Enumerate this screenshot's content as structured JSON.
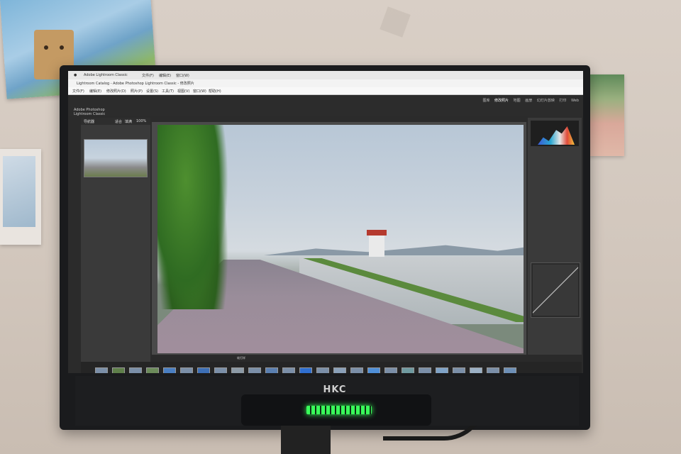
{
  "monitor": {
    "brand": "HKC"
  },
  "system_menu": [
    "Adobe Lightroom Classic",
    "文件(F)",
    "编辑(E)",
    "窗口(W)"
  ],
  "window_title": "Lightroom Catalog - Adobe Photoshop Lightroom Classic - 修改照片",
  "menubar": [
    "文件(F)",
    "编辑(E)",
    "修改照片(D)",
    "照片(P)",
    "设置(S)",
    "工具(T)",
    "视图(V)",
    "窗口(W)",
    "帮助(H)"
  ],
  "app": {
    "logo_line1": "Adobe Photoshop",
    "logo_line2": "Lightroom Classic",
    "modules": [
      "图库",
      "修改照片",
      "地图",
      "画册",
      "幻灯片放映",
      "打印",
      "Web"
    ],
    "active_module": "修改照片",
    "left_panel": {
      "navigator_title": "导航器",
      "zoom_options": [
        "适合",
        "填满",
        "100%"
      ]
    },
    "toolbar_label": "软打样"
  },
  "colors": {
    "accent_led": "#39ff5a",
    "lr_panel": "#3a3a3a",
    "screen_bg": "#2b2b2b"
  }
}
